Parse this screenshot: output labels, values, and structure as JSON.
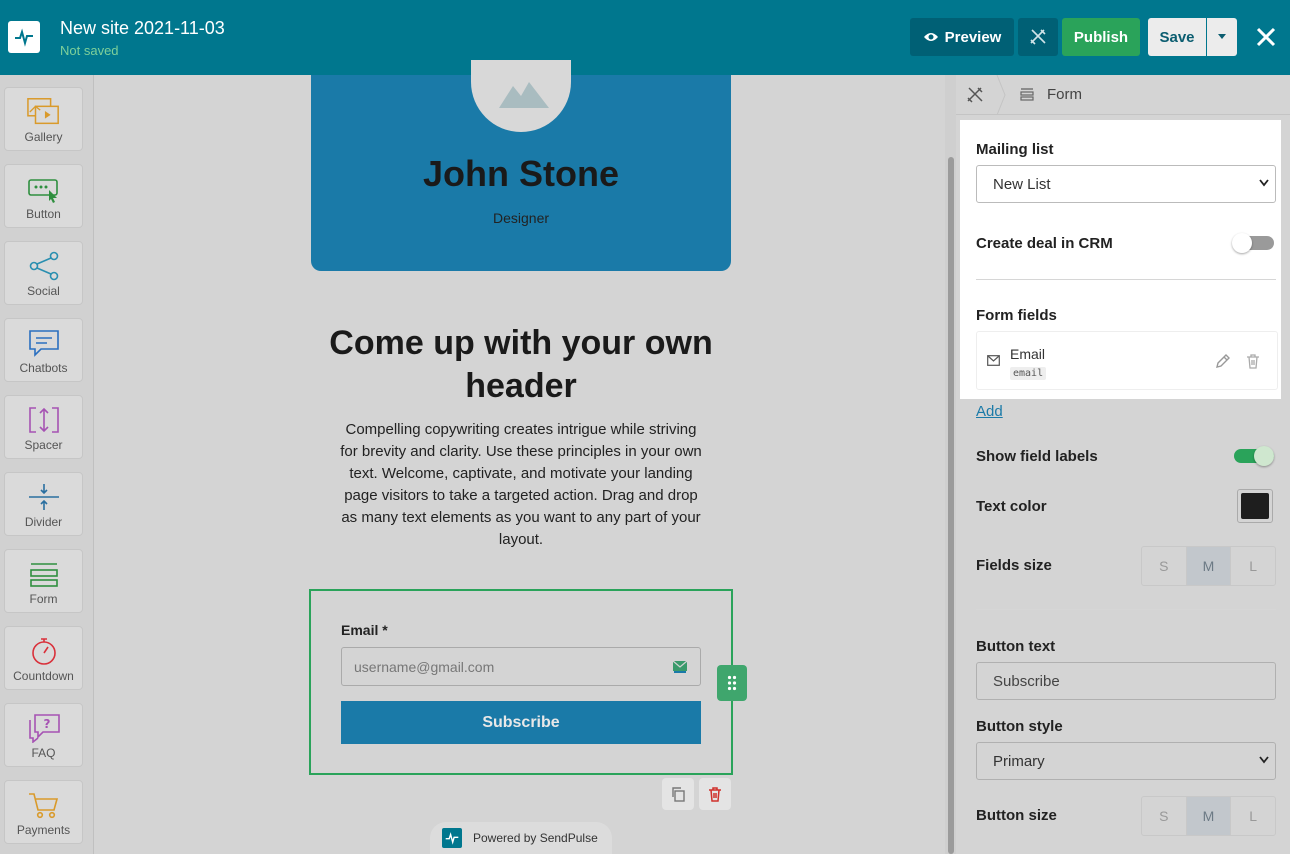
{
  "header": {
    "site_title": "New site 2021-11-03",
    "status": "Not saved",
    "preview_label": "Preview",
    "publish_label": "Publish",
    "save_label": "Save"
  },
  "sidebar": {
    "items": [
      {
        "label": "Gallery",
        "icon": "gallery-icon",
        "color": "#d99a2b"
      },
      {
        "label": "Button",
        "icon": "button-icon",
        "color": "#2f8f3f"
      },
      {
        "label": "Social",
        "icon": "share-icon",
        "color": "#2a8fb0"
      },
      {
        "label": "Chatbots",
        "icon": "chat-icon",
        "color": "#2a6fc0"
      },
      {
        "label": "Spacer",
        "icon": "spacer-icon",
        "color": "#a653b3"
      },
      {
        "label": "Divider",
        "icon": "divider-icon",
        "color": "#2a6fa0"
      },
      {
        "label": "Form",
        "icon": "form-icon",
        "color": "#2f8f3f"
      },
      {
        "label": "Countdown",
        "icon": "stopwatch-icon",
        "color": "#d9303a"
      },
      {
        "label": "FAQ",
        "icon": "faq-icon",
        "color": "#a653b3"
      },
      {
        "label": "Payments",
        "icon": "cart-icon",
        "color": "#d99a2b"
      }
    ]
  },
  "canvas": {
    "profile_name": "John Stone",
    "profile_role": "Designer",
    "headline": "Come up with your own header",
    "body": "Compelling copywriting creates intrigue while striving for brevity and clarity. Use these principles in your own text. Welcome, captivate, and motivate your landing page visitors to take a targeted action. Drag and drop as many text elements as you want to any part of your layout.",
    "form": {
      "email_label": "Email *",
      "email_placeholder": "username@gmail.com",
      "button_label": "Subscribe"
    },
    "powered_by": "Powered by SendPulse"
  },
  "panel": {
    "breadcrumb": "Form",
    "mailing_list_label": "Mailing list",
    "mailing_list_value": "New List",
    "create_deal_label": "Create deal in CRM",
    "create_deal_on": false,
    "form_fields_label": "Form fields",
    "fields": [
      {
        "name": "Email",
        "key": "email"
      }
    ],
    "add_label": "Add",
    "show_labels_label": "Show field labels",
    "show_labels_on": true,
    "text_color_label": "Text color",
    "text_color": "#1e1e1e",
    "fields_size_label": "Fields size",
    "sizes": [
      "S",
      "M",
      "L"
    ],
    "fields_size_selected": "M",
    "button_text_label": "Button text",
    "button_text_value": "Subscribe",
    "button_style_label": "Button style",
    "button_style_value": "Primary",
    "button_size_label": "Button size",
    "button_size_selected": "M"
  },
  "colors": {
    "topbar": "#00778e",
    "publish": "#2aa35a",
    "accent": "#1a7aa8"
  }
}
